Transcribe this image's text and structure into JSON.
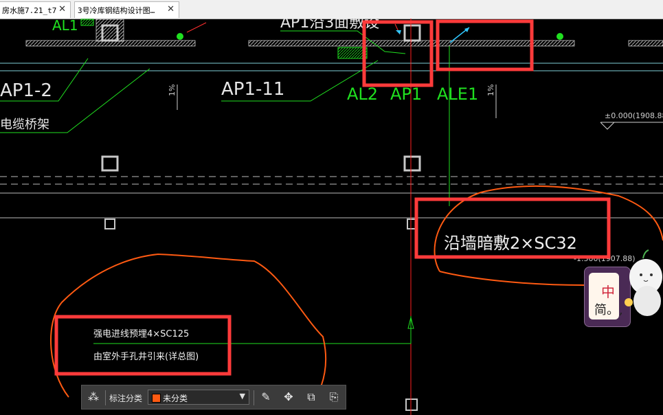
{
  "tabs": [
    {
      "label": "房水施7.21_t7",
      "close": "✕"
    },
    {
      "label": "3号冷库钢结构设计图…",
      "close": "✕"
    }
  ],
  "drawing": {
    "labels": {
      "al1": "AL1",
      "ap1_top": "AP1沿3面敷设",
      "ap1_2": "AP1-2",
      "ap1_11": "AP1-11",
      "al2": "AL2",
      "ap1": "AP1",
      "ale1": "ALE1",
      "slope1": "1%",
      "slope2": "1%",
      "cable_tray": "电缆桥架",
      "elev_top": "±0.000(1908.88)",
      "elev_mid": "-1.500(1907.88)",
      "wall_conduit": "沿墙暗敷2×SC32",
      "strong_power": "强电进线预埋4×SC125",
      "outdoor": "由室外手孔井引来(详总图)"
    }
  },
  "toolbar": {
    "label": "标注分类",
    "selected": "未分类",
    "swatch_color": "#ff5a12"
  },
  "ime": {
    "char1": "中",
    "char2": "简。,"
  },
  "colors": {
    "highlight": "#ff3b3b",
    "cloud": "#ff5a12",
    "green": "#20e020",
    "red_line": "#ff2020"
  }
}
